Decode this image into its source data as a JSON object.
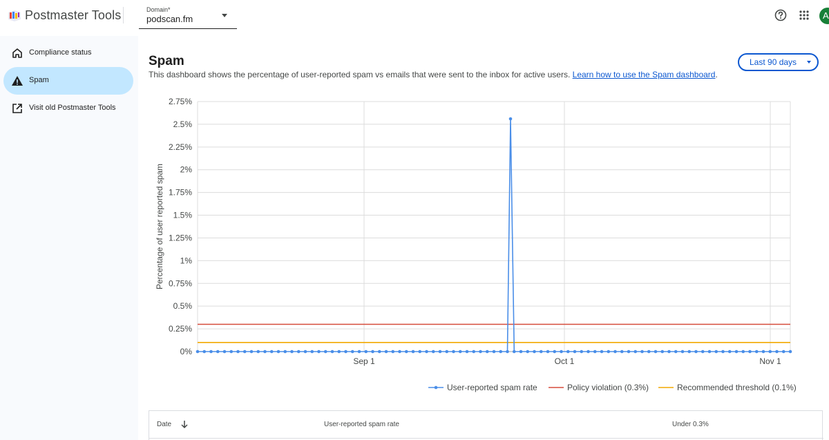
{
  "app": {
    "title": "Postmaster Tools"
  },
  "domain": {
    "label": "Domain*",
    "value": "podscan.fm"
  },
  "header": {
    "avatar_letter": "A",
    "icons": [
      "help-icon",
      "apps-grid-icon"
    ]
  },
  "sidebar": {
    "items": [
      {
        "label": "Compliance status",
        "icon": "home-icon",
        "active": false
      },
      {
        "label": "Spam",
        "icon": "warning-icon",
        "active": true
      },
      {
        "label": "Visit old Postmaster Tools",
        "icon": "open-in-new-icon",
        "active": false
      }
    ]
  },
  "main": {
    "title": "Spam",
    "description": "This dashboard shows the percentage of user-reported spam vs emails that were sent to the inbox for active users.",
    "link_text": "Learn how to use the Spam dashboard",
    "link_suffix": ".",
    "range_button": "Last 90 days"
  },
  "colors": {
    "accent": "#0b57d0",
    "spam_rate": "#4a8ee8",
    "policy": "#d64b3b",
    "threshold": "#f2a900",
    "active_nav": "#c2e7ff"
  },
  "chart_data": {
    "type": "line",
    "ylabel": "Percentage of user reported spam",
    "y_ticks": [
      "0%",
      "0.25%",
      "0.5%",
      "0.75%",
      "1%",
      "1.25%",
      "1.5%",
      "1.75%",
      "2%",
      "2.25%",
      "2.5%",
      "2.75%"
    ],
    "ylim": [
      0,
      2.75
    ],
    "x_ticks": [
      "Sep 1",
      "Oct 1",
      "Nov 1"
    ],
    "grid": true,
    "legend_position": "bottom-right",
    "series": [
      {
        "name": "User-reported spam rate",
        "color": "#4a8ee8",
        "values": [
          0,
          0,
          0,
          0,
          0,
          0,
          0,
          0,
          0,
          0,
          0,
          0,
          0,
          0,
          0,
          0,
          0,
          0,
          0,
          0,
          0,
          0,
          0,
          0,
          0,
          0,
          0,
          0,
          0,
          0,
          0,
          0,
          0,
          0,
          0,
          0,
          0,
          0,
          0,
          0,
          0,
          0,
          0,
          0,
          0,
          0,
          0,
          0,
          0,
          0,
          0,
          0,
          0,
          0,
          0,
          0,
          0,
          0,
          0,
          0,
          0,
          0,
          0,
          0,
          0,
          0,
          0,
          0,
          0,
          0,
          0,
          0,
          0,
          0,
          0,
          0,
          0,
          0,
          0,
          0,
          0,
          0,
          0,
          0,
          0,
          0,
          0,
          0,
          0
        ]
      },
      {
        "name": "Policy violation (0.3%)",
        "color": "#d64b3b",
        "constant": 0.3
      },
      {
        "name": "Recommended threshold (0.1%)",
        "color": "#f2a900",
        "constant": 0.1
      }
    ],
    "spike": {
      "value": 2.56
    }
  },
  "table": {
    "headers": [
      "Date",
      "User-reported spam rate",
      "Under 0.3%"
    ]
  }
}
